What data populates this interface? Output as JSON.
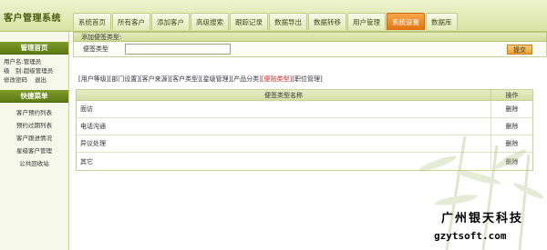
{
  "app": {
    "title": "客户管理系统"
  },
  "nav": {
    "tabs": [
      {
        "label": "系统首页",
        "active": false
      },
      {
        "label": "所有客户",
        "active": false
      },
      {
        "label": "添加客户",
        "active": false
      },
      {
        "label": "高级搜索",
        "active": false
      },
      {
        "label": "跟踪记录",
        "active": false
      },
      {
        "label": "数据导出",
        "active": false
      },
      {
        "label": "数据转移",
        "active": false
      },
      {
        "label": "用户管理",
        "active": false
      },
      {
        "label": "系统设置",
        "active": true
      },
      {
        "label": "数据库",
        "active": false
      }
    ]
  },
  "sidebar": {
    "home_title": "管理首页",
    "user_line": "用户名:管理员",
    "level_line": "级　别:超级管理员",
    "change_password": "修改密码",
    "logout": "退出",
    "quick_title": "快捷菜单",
    "quick_items": [
      {
        "label": "客户预约列表"
      },
      {
        "label": "预约过期列表"
      },
      {
        "label": "客户跟进情况"
      },
      {
        "label": "星级客户管理"
      },
      {
        "label": "公共回收站"
      }
    ]
  },
  "main": {
    "panel_title": "添加便签类型:",
    "form": {
      "type_label": "便签类型",
      "type_value": "",
      "submit_label": "提交"
    },
    "sub_links": [
      {
        "label": "[用户等级]",
        "current": false
      },
      {
        "label": "[部门设置]",
        "current": false
      },
      {
        "label": "[客户来源]",
        "current": false
      },
      {
        "label": "[客户类型]",
        "current": false
      },
      {
        "label": "[星级管理]",
        "current": false
      },
      {
        "label": "[产品分类]",
        "current": false
      },
      {
        "label": "[便贴类型]",
        "current": true
      },
      {
        "label": "[职位管理]",
        "current": false
      }
    ],
    "table": {
      "headers": {
        "name": "便签类型名称",
        "op": "操作"
      },
      "rows": [
        {
          "name": "面访",
          "op": "删除"
        },
        {
          "name": "电话沟通",
          "op": "删除"
        },
        {
          "name": "异议处理",
          "op": "删除"
        },
        {
          "name": "其它",
          "op": "删除"
        }
      ]
    }
  },
  "watermark": {
    "brand_name": "广州银天科技",
    "brand_url": "gzytsoft.com"
  },
  "colors": {
    "accent_tab": "#e98420",
    "header_green": "#d8e3a2",
    "sidebar_head": "#6a8a1c",
    "current_link": "#e0201a"
  }
}
